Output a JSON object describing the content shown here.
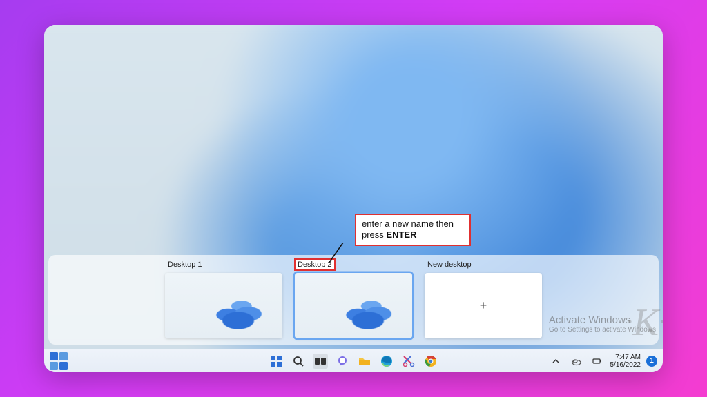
{
  "taskview": {
    "desktops": [
      {
        "label": "Desktop 1",
        "active": false
      },
      {
        "label": "Desktop 2",
        "active": true,
        "editing": true
      }
    ],
    "new_desktop_label": "New desktop",
    "new_desktop_icon": "+"
  },
  "callout": {
    "text_prefix": "enter a new name then press ",
    "text_bold": "ENTER"
  },
  "watermark": {
    "title": "Activate Windows",
    "subtitle": "Go to Settings to activate Windows"
  },
  "taskbar": {
    "icons": {
      "widgets": "widgets-icon",
      "start": "start-icon",
      "search": "search-icon",
      "taskview": "task-view-icon",
      "chat": "chat-icon",
      "explorer": "file-explorer-icon",
      "edge": "edge-icon",
      "snip": "snipping-tool-icon",
      "chrome": "chrome-icon"
    },
    "systray": {
      "chevron": "chevron-up-icon",
      "onedrive": "onedrive-icon",
      "battery": "battery-icon",
      "volume": "volume-icon"
    },
    "clock": {
      "time": "7:47 AM",
      "date": "5/16/2022"
    },
    "notification_count": "1"
  },
  "overlay_logo": "K"
}
